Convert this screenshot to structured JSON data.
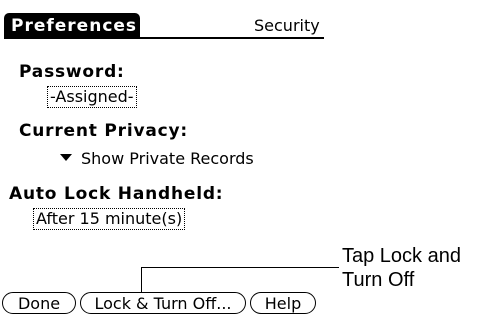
{
  "title_bar": {
    "app_title": "Preferences",
    "panel_selector": "Security"
  },
  "password": {
    "label": "Password:",
    "value": "-Assigned-"
  },
  "privacy": {
    "label": "Current Privacy:",
    "selected": "Show Private Records"
  },
  "auto_lock": {
    "label": "Auto Lock Handheld:",
    "value": "After 15 minute(s)"
  },
  "buttons": {
    "done": "Done",
    "lock": "Lock & Turn Off...",
    "help": "Help"
  },
  "callout": {
    "line1": "Tap Lock and",
    "line2": "Turn Off"
  },
  "icons": {
    "dropdown": "triangle-down-icon"
  },
  "colors": {
    "foreground": "#000000",
    "background": "#ffffff"
  }
}
